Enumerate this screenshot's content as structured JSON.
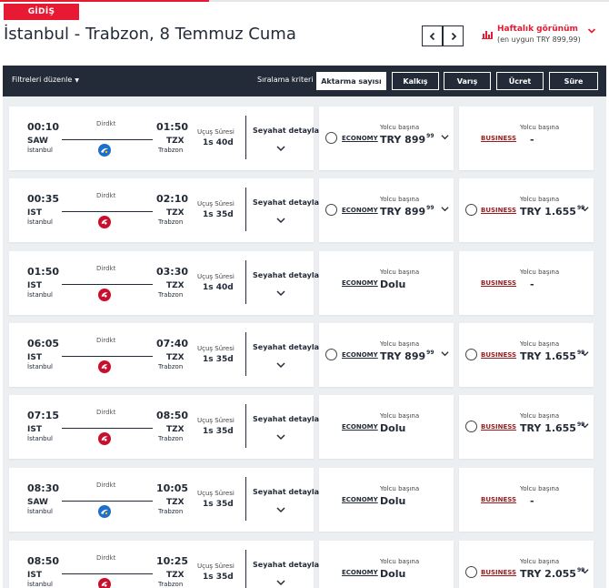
{
  "header": {
    "direction_badge": "GİDİŞ",
    "title": "İstanbul - Trabzon, 8 Temmuz Cuma",
    "weekly_view_title": "Haftalık görünüm",
    "weekly_view_subtitle": "(en uygun TRY 899,99)"
  },
  "filter_bar": {
    "edit_filters": "Filtreleri düzenle",
    "sort_label": "Sıralama kriteri",
    "sort_options": [
      "Aktarma sayısı",
      "Kalkış",
      "Varış",
      "Ücret",
      "Süre"
    ],
    "active_sort": "Aktarma sayısı"
  },
  "labels": {
    "direct": "Dirdkt",
    "duration_label": "Uçuş Süresi",
    "details": "Seyahat detayları",
    "economy": "ECONOMY",
    "business": "BUSINESS",
    "per_passenger": "Yolcu başına",
    "sold_out": "Dolu"
  },
  "colors": {
    "brand_red": "#e81932",
    "navy": "#232b38",
    "pegasus_blue": "#1d6fc9",
    "business_red": "#9b1c1c"
  },
  "flights": [
    {
      "dep_time": "00:10",
      "dep_code": "SAW",
      "dep_city": "İstanbul",
      "arr_time": "01:50",
      "arr_code": "TZX",
      "arr_city": "Trabzon",
      "duration": "1s 40d",
      "airline_logo": "anadolujet-logo",
      "economy": {
        "selectable": true,
        "price": "TRY 899",
        "decimals": "99"
      },
      "business": {
        "selectable": false,
        "price": "-",
        "decimals": ""
      }
    },
    {
      "dep_time": "00:35",
      "dep_code": "IST",
      "dep_city": "İstanbul",
      "arr_time": "02:10",
      "arr_code": "TZX",
      "arr_city": "Trabzon",
      "duration": "1s 35d",
      "airline_logo": "turkish-airlines-logo",
      "economy": {
        "selectable": true,
        "price": "TRY 899",
        "decimals": "99"
      },
      "business": {
        "selectable": true,
        "price": "TRY 1.655",
        "decimals": "99"
      }
    },
    {
      "dep_time": "01:50",
      "dep_code": "IST",
      "dep_city": "İstanbul",
      "arr_time": "03:30",
      "arr_code": "TZX",
      "arr_city": "Trabzon",
      "duration": "1s 40d",
      "airline_logo": "turkish-airlines-logo",
      "economy": {
        "selectable": false,
        "price": "Dolu",
        "decimals": ""
      },
      "business": {
        "selectable": false,
        "price": "-",
        "decimals": ""
      }
    },
    {
      "dep_time": "06:05",
      "dep_code": "IST",
      "dep_city": "İstanbul",
      "arr_time": "07:40",
      "arr_code": "TZX",
      "arr_city": "Trabzon",
      "duration": "1s 35d",
      "airline_logo": "turkish-airlines-logo",
      "economy": {
        "selectable": true,
        "price": "TRY 899",
        "decimals": "99"
      },
      "business": {
        "selectable": true,
        "price": "TRY 1.655",
        "decimals": "99"
      }
    },
    {
      "dep_time": "07:15",
      "dep_code": "IST",
      "dep_city": "İstanbul",
      "arr_time": "08:50",
      "arr_code": "TZX",
      "arr_city": "Trabzon",
      "duration": "1s 35d",
      "airline_logo": "turkish-airlines-logo",
      "economy": {
        "selectable": false,
        "price": "Dolu",
        "decimals": ""
      },
      "business": {
        "selectable": true,
        "price": "TRY 1.655",
        "decimals": "99"
      }
    },
    {
      "dep_time": "08:30",
      "dep_code": "SAW",
      "dep_city": "İstanbul",
      "arr_time": "10:05",
      "arr_code": "TZX",
      "arr_city": "Trabzon",
      "duration": "1s 35d",
      "airline_logo": "anadolujet-logo",
      "economy": {
        "selectable": false,
        "price": "Dolu",
        "decimals": ""
      },
      "business": {
        "selectable": false,
        "price": "-",
        "decimals": ""
      }
    },
    {
      "dep_time": "08:50",
      "dep_code": "IST",
      "dep_city": "İstanbul",
      "arr_time": "10:25",
      "arr_code": "TZX",
      "arr_city": "Trabzon",
      "duration": "1s 35d",
      "airline_logo": "turkish-airlines-logo",
      "economy": {
        "selectable": false,
        "price": "Dolu",
        "decimals": ""
      },
      "business": {
        "selectable": true,
        "price": "TRY 2.055",
        "decimals": "99"
      }
    }
  ]
}
